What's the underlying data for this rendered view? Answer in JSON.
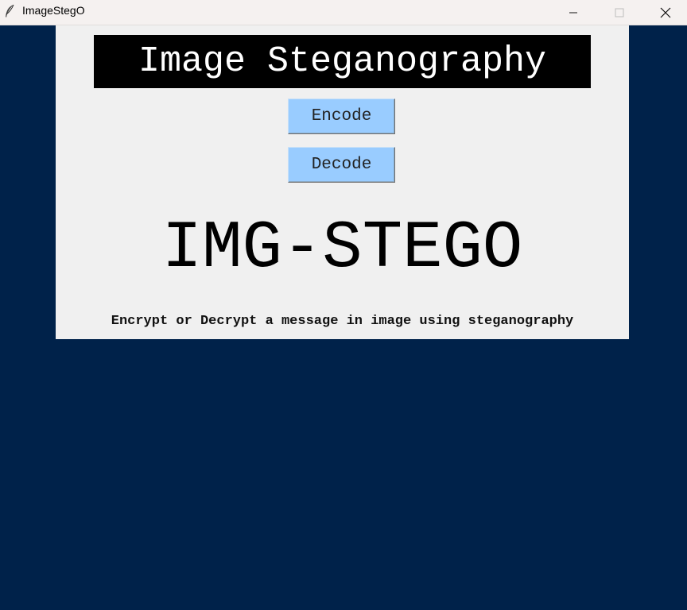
{
  "window": {
    "title": "ImageStegO",
    "icon": "feather-icon",
    "controls": {
      "minimize_icon": "minimize-icon",
      "maximize_icon": "maximize-icon",
      "close_icon": "close-icon"
    }
  },
  "main": {
    "heading": "Image Steganography",
    "buttons": {
      "encode_label": "Encode",
      "decode_label": "Decode"
    },
    "logo_text": "IMG-STEGO",
    "tagline": "Encrypt or Decrypt a message in image using steganography"
  },
  "colors": {
    "background": "#00224a",
    "panel": "#f0f0f0",
    "heading_bg": "#000000",
    "heading_text": "#ffffff",
    "button_bg": "#99ccff"
  }
}
